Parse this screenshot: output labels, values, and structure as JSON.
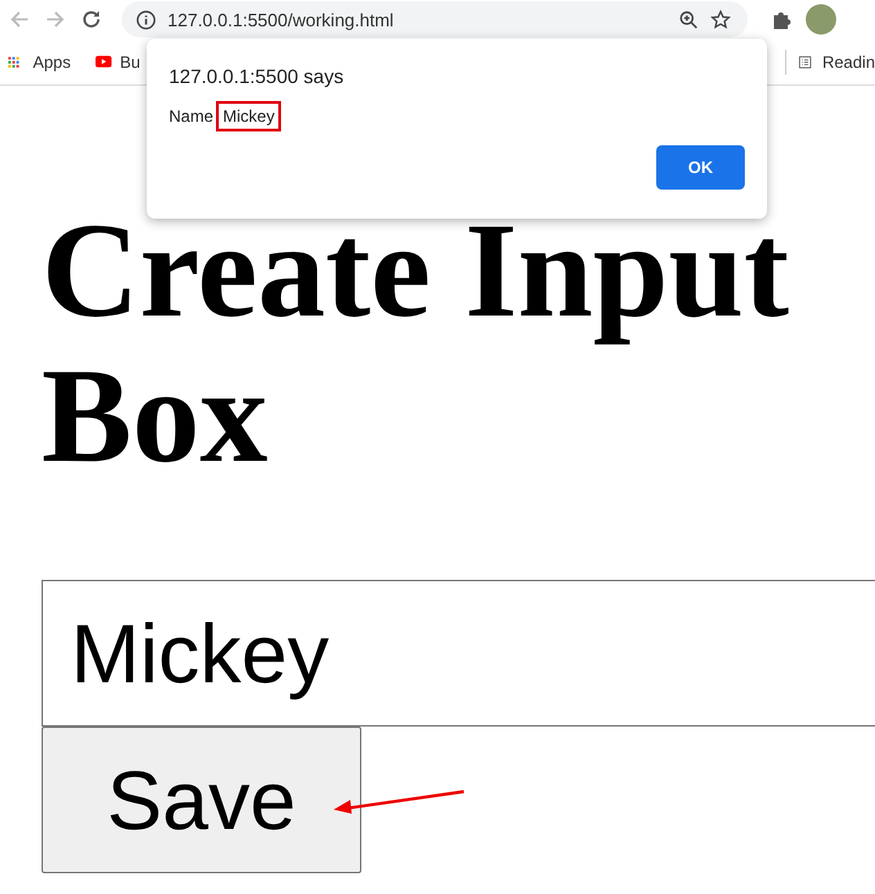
{
  "browser": {
    "url": "127.0.0.1:5500/working.html",
    "bookmarks": [
      {
        "label": "Apps",
        "kind": "apps"
      },
      {
        "label": "Bu",
        "kind": "video"
      }
    ],
    "reading_list": "Readin"
  },
  "dialog": {
    "title": "127.0.0.1:5500 says",
    "label": "Name",
    "value": "Mickey",
    "ok": "OK"
  },
  "page": {
    "heading": "Create Input Box",
    "input_value": "Mickey",
    "button": "Save"
  }
}
